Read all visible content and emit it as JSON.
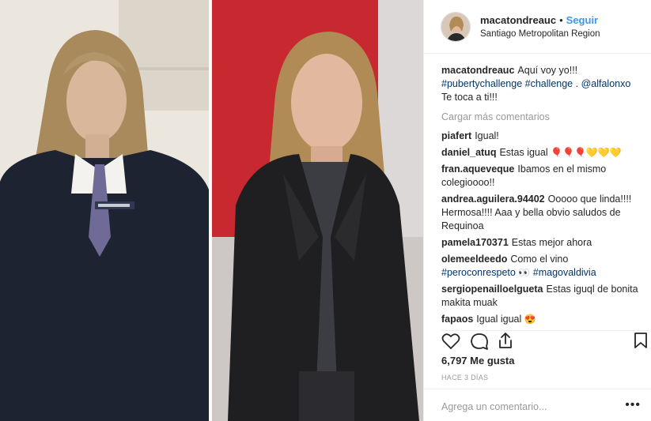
{
  "post": {
    "username": "macatondreauc",
    "follow_label": "Seguir",
    "separator": "•",
    "location": "Santiago Metropolitan Region"
  },
  "caption": {
    "username": "macatondreauc",
    "line1": "Aquí voy yo!!!",
    "tags": [
      "#pubertychallenge",
      "#challenge",
      ".",
      "@alfalonxo"
    ],
    "line3": "Te toca a ti!!!"
  },
  "load_more": "Cargar más comentarios",
  "comments": [
    {
      "user": "piafert",
      "text": "Igual!"
    },
    {
      "user": "daniel_atuq",
      "text": "Estas igual",
      "emoji": "🎈🎈🎈💛💛💛"
    },
    {
      "user": "fran.aqueveque",
      "text": "Ibamos en el mismo colegioooo!!"
    },
    {
      "user": "andrea.aguilera.94402",
      "text": "Ooooo que linda!!!! Hermosa!!!! Aaa y bella obvio saludos de Requinoa"
    },
    {
      "user": "pamela170371",
      "text": "Estas mejor ahora"
    },
    {
      "user": "olemeeldeedo",
      "text": "Como el vino",
      "tags": [
        "#peroconrespeto",
        "👀",
        "#magovaldivia"
      ]
    },
    {
      "user": "sergiopenailloelgueta",
      "text": "Estas iguql de bonita makita muak"
    },
    {
      "user": "fapaos",
      "text": "Igual igual",
      "emoji": "😍"
    }
  ],
  "icons": [
    "heart-icon",
    "comment-icon",
    "share-icon",
    "bookmark-icon",
    "more-options-icon"
  ],
  "likes": "6,797 Me gusta",
  "age": "HACE 3 DÍAS",
  "comment_input": {
    "placeholder": "Agrega un comentario...",
    "more": "•••"
  },
  "colors": {
    "link": "#003569",
    "follow": "#3897f0",
    "muted": "#999999"
  }
}
